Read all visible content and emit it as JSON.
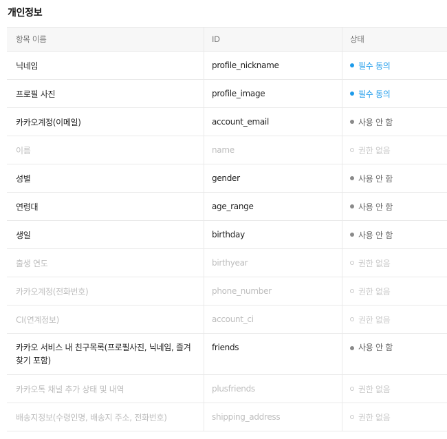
{
  "section_title": "개인정보",
  "table": {
    "headers": {
      "name": "항목 이름",
      "id": "ID",
      "status": "상태"
    },
    "status_colors": {
      "required": "#1e9bea",
      "unused": "#8a8a8a",
      "none": "#c8c8c8"
    },
    "rows": [
      {
        "name": "닉네임",
        "id": "profile_nickname",
        "status": "필수 동의",
        "status_type": "required",
        "dim": false
      },
      {
        "name": "프로필 사진",
        "id": "profile_image",
        "status": "필수 동의",
        "status_type": "required",
        "dim": false
      },
      {
        "name": "카카오계정(이메일)",
        "id": "account_email",
        "status": "사용 안 함",
        "status_type": "unused",
        "dim": false
      },
      {
        "name": "이름",
        "id": "name",
        "status": "권한 없음",
        "status_type": "none",
        "dim": true
      },
      {
        "name": "성별",
        "id": "gender",
        "status": "사용 안 함",
        "status_type": "unused",
        "dim": false
      },
      {
        "name": "연령대",
        "id": "age_range",
        "status": "사용 안 함",
        "status_type": "unused",
        "dim": false
      },
      {
        "name": "생일",
        "id": "birthday",
        "status": "사용 안 함",
        "status_type": "unused",
        "dim": false
      },
      {
        "name": "출생 연도",
        "id": "birthyear",
        "status": "권한 없음",
        "status_type": "none",
        "dim": true
      },
      {
        "name": "카카오계정(전화번호)",
        "id": "phone_number",
        "status": "권한 없음",
        "status_type": "none",
        "dim": true
      },
      {
        "name": "CI(연계정보)",
        "id": "account_ci",
        "status": "권한 없음",
        "status_type": "none",
        "dim": true
      },
      {
        "name": "카카오 서비스 내 친구목록(프로필사진, 닉네임, 즐겨찾기 포함)",
        "id": "friends",
        "status": "사용 안 함",
        "status_type": "unused",
        "dim": false
      },
      {
        "name": "카카오톡 채널 추가 상태 및 내역",
        "id": "plusfriends",
        "status": "권한 없음",
        "status_type": "none",
        "dim": true
      },
      {
        "name": "배송지정보(수령인명, 배송지 주소, 전화번호)",
        "id": "shipping_address",
        "status": "권한 없음",
        "status_type": "none",
        "dim": true
      }
    ]
  }
}
